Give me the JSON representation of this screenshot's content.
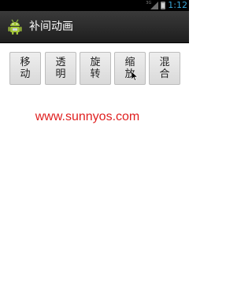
{
  "status_bar": {
    "network_type": "3G",
    "time": "1:12",
    "time_color": "#3aa7d8",
    "icons": [
      "signal-icon",
      "battery-icon"
    ]
  },
  "title_bar": {
    "app_icon": "android-icon",
    "title": "补间动画"
  },
  "buttons": [
    {
      "label": "移\n动"
    },
    {
      "label": "透\n明"
    },
    {
      "label": "旋\n转"
    },
    {
      "label": "缩\n放"
    },
    {
      "label": "混\n合"
    }
  ],
  "content": {
    "link_text": "www.sunnyos.com",
    "link_color": "#e02020"
  }
}
